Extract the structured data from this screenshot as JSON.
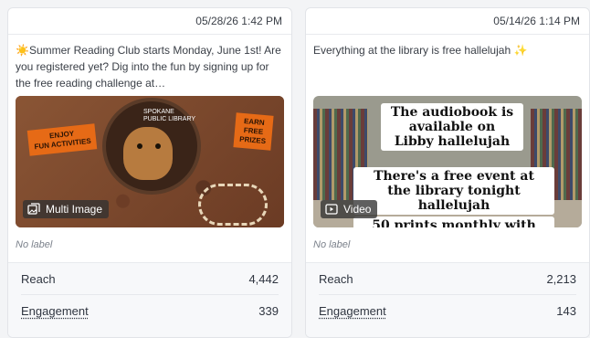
{
  "cards": [
    {
      "date": "05/28/26 1:42 PM",
      "caption": "☀️Summer Reading Club starts Monday, June 1st! Are you registered yet? Dig into the fun by signing up for the free reading challenge at…",
      "media": {
        "type_label": "Multi Image",
        "icon": "multi-image-icon",
        "sign_left": "ENJOY\nFUN ACTIVITIES",
        "sign_right": "EARN\nFREE\nPRIZES",
        "logo_text": "SPOKANE\nPUBLIC LIBRARY"
      },
      "label": "No label",
      "stats": [
        {
          "name": "Reach",
          "value": "4,442"
        },
        {
          "name": "Engagement",
          "value": "339"
        }
      ]
    },
    {
      "date": "05/14/26 1:14 PM",
      "caption": "Everything at the library is free hallelujah ✨",
      "media": {
        "type_label": "Video",
        "icon": "video-icon",
        "text1": "The audiobook is available on Libby hallelujah",
        "text2": "There's a free event at the library tonight hallelujah",
        "text3": "50 prints monthly with"
      },
      "label": "No label",
      "stats": [
        {
          "name": "Reach",
          "value": "2,213"
        },
        {
          "name": "Engagement",
          "value": "143"
        }
      ]
    }
  ]
}
